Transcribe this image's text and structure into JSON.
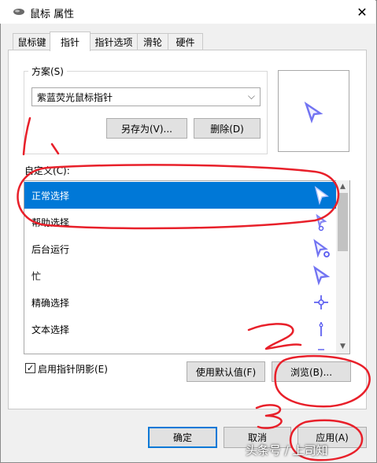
{
  "window": {
    "title": "鼠标 属性",
    "close_glyph": "✕"
  },
  "tabs": [
    {
      "label": "鼠标键",
      "active": false
    },
    {
      "label": "指针",
      "active": true
    },
    {
      "label": "指针选项",
      "active": false
    },
    {
      "label": "滑轮",
      "active": false
    },
    {
      "label": "硬件",
      "active": false
    }
  ],
  "scheme": {
    "group_label": "方案(S)",
    "selected": "紫蓝荧光鼠标指针",
    "save_as_label": "另存为(V)...",
    "delete_label": "删除(D)"
  },
  "customize": {
    "label": "自定义(C):",
    "items": [
      {
        "label": "正常选择",
        "icon": "arrow-cursor-icon",
        "selected": true
      },
      {
        "label": "帮助选择",
        "icon": "help-cursor-icon",
        "selected": false
      },
      {
        "label": "后台运行",
        "icon": "working-cursor-icon",
        "selected": false
      },
      {
        "label": "忙",
        "icon": "busy-cursor-icon",
        "selected": false
      },
      {
        "label": "精确选择",
        "icon": "crosshair-cursor-icon",
        "selected": false
      },
      {
        "label": "文本选择",
        "icon": "text-cursor-icon",
        "selected": false
      }
    ]
  },
  "options": {
    "shadow_label": "启用指针阴影(E)",
    "shadow_checked": true,
    "default_label": "使用默认值(F)",
    "browse_label": "浏览(B)..."
  },
  "footer": {
    "ok_label": "确定",
    "cancel_label": "取消",
    "apply_label": "应用(A)"
  },
  "annotations": {
    "n1": "1",
    "n2": "2",
    "n3": "3"
  },
  "watermark": "头条号 / 上司知",
  "colors": {
    "accent": "#0078d7",
    "annotation": "#e8202a",
    "cursor_glow": "#5a5cf0"
  }
}
